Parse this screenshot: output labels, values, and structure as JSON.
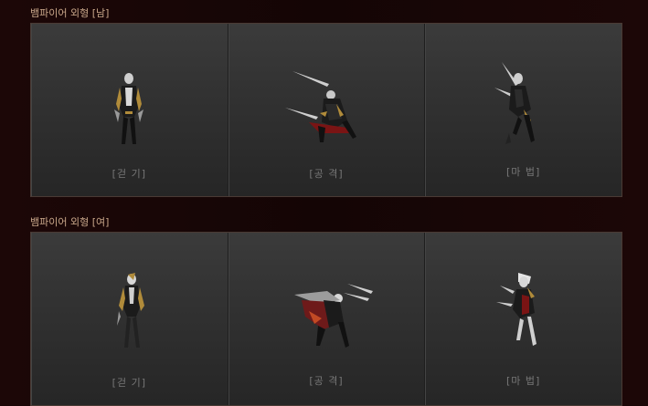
{
  "sections": [
    {
      "title": "뱀파이어 외형 [남]",
      "cells": [
        {
          "label": "[걷 기]",
          "figure": "vampire-male-walk"
        },
        {
          "label": "[공 격]",
          "figure": "vampire-male-attack"
        },
        {
          "label": "[마 법]",
          "figure": "vampire-male-magic"
        }
      ]
    },
    {
      "title": "뱀파이어 외형 [여]",
      "cells": [
        {
          "label": "[걷 기]",
          "figure": "vampire-female-walk"
        },
        {
          "label": "[공 격]",
          "figure": "vampire-female-attack"
        },
        {
          "label": "[마 법]",
          "figure": "vampire-female-magic"
        }
      ]
    }
  ],
  "colors": {
    "page_bg": "#1a0606",
    "title": "#c9a78a",
    "label": "#777777",
    "panel_border": "#4a3a34"
  }
}
